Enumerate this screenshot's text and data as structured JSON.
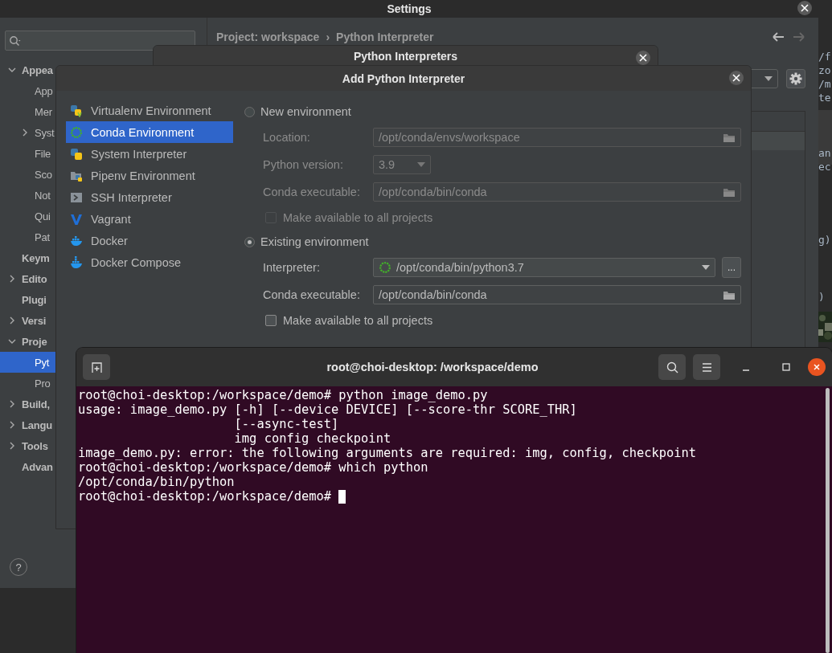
{
  "settings": {
    "title": "Settings",
    "tree": [
      {
        "label": "Appea",
        "expanded": true,
        "selected": false,
        "children": [
          {
            "label": "App",
            "selected": false
          },
          {
            "label": "Mer",
            "selected": false
          },
          {
            "label": "Syst",
            "expanded": false,
            "selected": false
          },
          {
            "label": "File",
            "selected": false
          },
          {
            "label": "Sco",
            "selected": false
          },
          {
            "label": "Not",
            "selected": false
          },
          {
            "label": "Qui",
            "selected": false
          },
          {
            "label": "Pat",
            "selected": false
          }
        ]
      },
      {
        "label": "Keym",
        "selected": false
      },
      {
        "label": "Edito",
        "expanded": false,
        "selected": false
      },
      {
        "label": "Plugi",
        "selected": false
      },
      {
        "label": "Versi",
        "expanded": false,
        "selected": false
      },
      {
        "label": "Proje",
        "expanded": true,
        "selected": false,
        "children": [
          {
            "label": "Pyt",
            "selected": true
          },
          {
            "label": "Pro",
            "selected": false
          }
        ]
      },
      {
        "label": "Build,",
        "expanded": false,
        "selected": false
      },
      {
        "label": "Langu",
        "expanded": false,
        "selected": false
      },
      {
        "label": "Tools",
        "expanded": false,
        "selected": false
      },
      {
        "label": "Advan",
        "selected": false
      }
    ],
    "breadcrumb": [
      "Project: workspace",
      "›",
      "Python Interpreter"
    ],
    "help_button": "?"
  },
  "editor_fragments": [
    [
      "/f",
      "zo",
      "/m",
      "te"
    ],
    [
      "an",
      "ec"
    ],
    [
      "g)"
    ],
    [
      ")"
    ]
  ],
  "python_interpreters_dialog": {
    "title": "Python Interpreters"
  },
  "add_interpreter_dialog": {
    "title": "Add Python Interpreter",
    "environment_types": [
      {
        "kind": "virtualenv",
        "label": "Virtualenv Environment",
        "selected": false
      },
      {
        "kind": "conda",
        "label": "Conda Environment",
        "selected": true
      },
      {
        "kind": "system",
        "label": "System Interpreter",
        "selected": false
      },
      {
        "kind": "pipenv",
        "label": "Pipenv Environment",
        "selected": false
      },
      {
        "kind": "ssh",
        "label": "SSH Interpreter",
        "selected": false
      },
      {
        "kind": "vagrant",
        "label": "Vagrant",
        "selected": false
      },
      {
        "kind": "docker",
        "label": "Docker",
        "selected": false
      },
      {
        "kind": "compose",
        "label": "Docker Compose",
        "selected": false
      }
    ],
    "options": [
      {
        "label": "New environment",
        "selected": false,
        "fields": [
          {
            "kind": "path",
            "label": "Location:",
            "value": "/opt/conda/envs/workspace",
            "disabled": true
          },
          {
            "kind": "dropdown",
            "label": "Python version:",
            "value": "3.9",
            "disabled": true
          },
          {
            "kind": "path",
            "label": "Conda executable:",
            "value": "/opt/conda/bin/conda",
            "disabled": true
          }
        ],
        "checkbox": {
          "label": "Make available to all projects",
          "checked": false,
          "disabled": true
        }
      },
      {
        "label": "Existing environment",
        "selected": true,
        "fields": [
          {
            "kind": "combo",
            "label": "Interpreter:",
            "value": "/opt/conda/bin/python3.7",
            "button": "...",
            "disabled": false
          },
          {
            "kind": "path",
            "label": "Conda executable:",
            "value": "/opt/conda/bin/conda",
            "disabled": false
          }
        ],
        "checkbox": {
          "label": "Make available to all projects",
          "checked": false,
          "disabled": false
        }
      }
    ]
  },
  "terminal": {
    "title": "root@choi-desktop: /workspace/demo",
    "lines": [
      "root@choi-desktop:/workspace/demo# python image_demo.py",
      "usage: image_demo.py [-h] [--device DEVICE] [--score-thr SCORE_THR]",
      "                     [--async-test]",
      "                     img config checkpoint",
      "image_demo.py: error: the following arguments are required: img, config, checkpoint",
      "root@choi-desktop:/workspace/demo# which python",
      "/opt/conda/bin/python",
      "root@choi-desktop:/workspace/demo# "
    ],
    "cursor": true
  }
}
